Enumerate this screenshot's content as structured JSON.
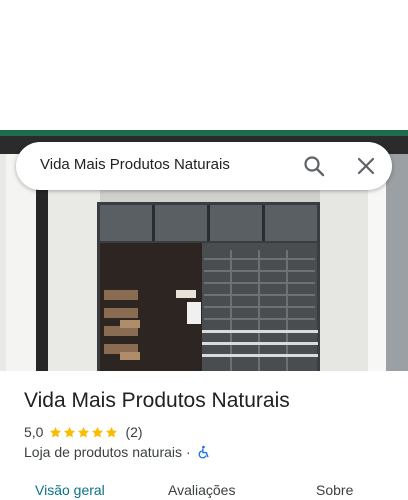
{
  "search": {
    "query": "Vida Mais Produtos Naturais"
  },
  "place": {
    "name": "Vida Mais Produtos Naturais",
    "rating": "5,0",
    "stars": 5,
    "review_count": "(2)",
    "category": "Loja de produtos naturais",
    "separator": "·"
  },
  "tabs": [
    {
      "label": "Visão geral",
      "active": true
    },
    {
      "label": "Avaliações",
      "active": false
    },
    {
      "label": "Sobre",
      "active": false
    }
  ],
  "colors": {
    "star": "#fbbc04",
    "accent": "#0b7285",
    "accessibility": "#1a73e8"
  },
  "icons": {
    "search": "search-icon",
    "close": "close-icon",
    "accessibility": "wheelchair-icon"
  }
}
